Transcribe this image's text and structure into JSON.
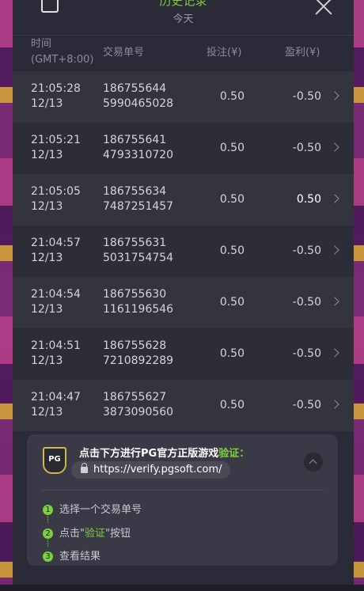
{
  "header": {
    "title": "历史记录",
    "subtitle": "今天"
  },
  "columns": {
    "time": "时间",
    "timezone": "(GMT+8:00)",
    "order": "交易单号",
    "bet": "投注(¥)",
    "profit": "盈利(¥)"
  },
  "rows": [
    {
      "time": "21:05:28",
      "date": "12/13",
      "order1": "186755644",
      "order2": "5990465028",
      "bet": "0.50",
      "profit": "-0.50"
    },
    {
      "time": "21:05:21",
      "date": "12/13",
      "order1": "186755641",
      "order2": "4793310720",
      "bet": "0.50",
      "profit": "-0.50"
    },
    {
      "time": "21:05:05",
      "date": "12/13",
      "order1": "186755634",
      "order2": "7487251457",
      "bet": "0.50",
      "profit": "0.50"
    },
    {
      "time": "21:04:57",
      "date": "12/13",
      "order1": "186755631",
      "order2": "5031754754",
      "bet": "0.50",
      "profit": "-0.50"
    },
    {
      "time": "21:04:54",
      "date": "12/13",
      "order1": "186755630",
      "order2": "1161196546",
      "bet": "0.50",
      "profit": "-0.50"
    },
    {
      "time": "21:04:51",
      "date": "12/13",
      "order1": "186755628",
      "order2": "7210892289",
      "bet": "0.50",
      "profit": "-0.50"
    },
    {
      "time": "21:04:47",
      "date": "12/13",
      "order1": "186755627",
      "order2": "3873090560",
      "bet": "0.50",
      "profit": "-0.50"
    }
  ],
  "verify": {
    "logo": "PG",
    "text_prefix": "点击下方进行PG官方正版游戏",
    "text_highlight": "验证：",
    "url": "https://verify.pgsoft.com/",
    "steps": [
      {
        "num": "1",
        "pre": "选择一个交易单号",
        "hl": "",
        "post": ""
      },
      {
        "num": "2",
        "pre": "点击\"",
        "hl": "验证",
        "post": "\"按钮"
      },
      {
        "num": "3",
        "pre": "查看结果",
        "hl": "",
        "post": ""
      }
    ]
  },
  "colors": {
    "accent": "#7dd13d",
    "panel": "#2b2b37",
    "text": "#d4d4dc"
  }
}
